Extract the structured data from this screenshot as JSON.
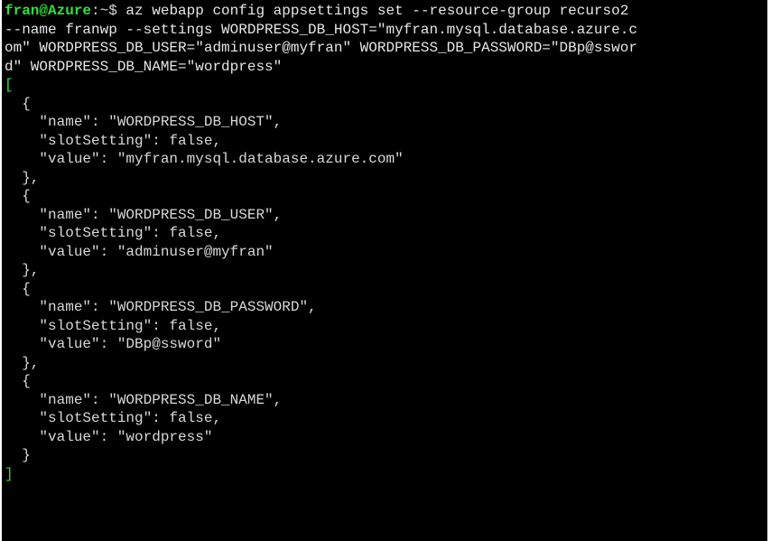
{
  "terminal": {
    "prompt": {
      "user_host": "fran@Azure",
      "path_symbol": ":~$",
      "command_lines": [
        " az webapp config appsettings set --resource-group recurso2",
        "--name franwp --settings WORDPRESS_DB_HOST=\"myfran.mysql.database.azure.c",
        "om\" WORDPRESS_DB_USER=\"adminuser@myfran\" WORDPRESS_DB_PASSWORD=\"DBp@sswor",
        "d\" WORDPRESS_DB_NAME=\"wordpress\""
      ]
    },
    "open_bracket": "[",
    "output_lines": [
      "  {",
      "    \"name\": \"WORDPRESS_DB_HOST\",",
      "    \"slotSetting\": false,",
      "    \"value\": \"myfran.mysql.database.azure.com\"",
      "  },",
      "  {",
      "    \"name\": \"WORDPRESS_DB_USER\",",
      "    \"slotSetting\": false,",
      "    \"value\": \"adminuser@myfran\"",
      "  },",
      "  {",
      "    \"name\": \"WORDPRESS_DB_PASSWORD\",",
      "    \"slotSetting\": false,",
      "    \"value\": \"DBp@ssword\"",
      "  },",
      "  {",
      "    \"name\": \"WORDPRESS_DB_NAME\",",
      "    \"slotSetting\": false,",
      "    \"value\": \"wordpress\"",
      "  }"
    ],
    "close_bracket": "]",
    "colors": {
      "background": "#000000",
      "prompt_user": "#2ee03c",
      "text": "#d8d8d8"
    }
  }
}
